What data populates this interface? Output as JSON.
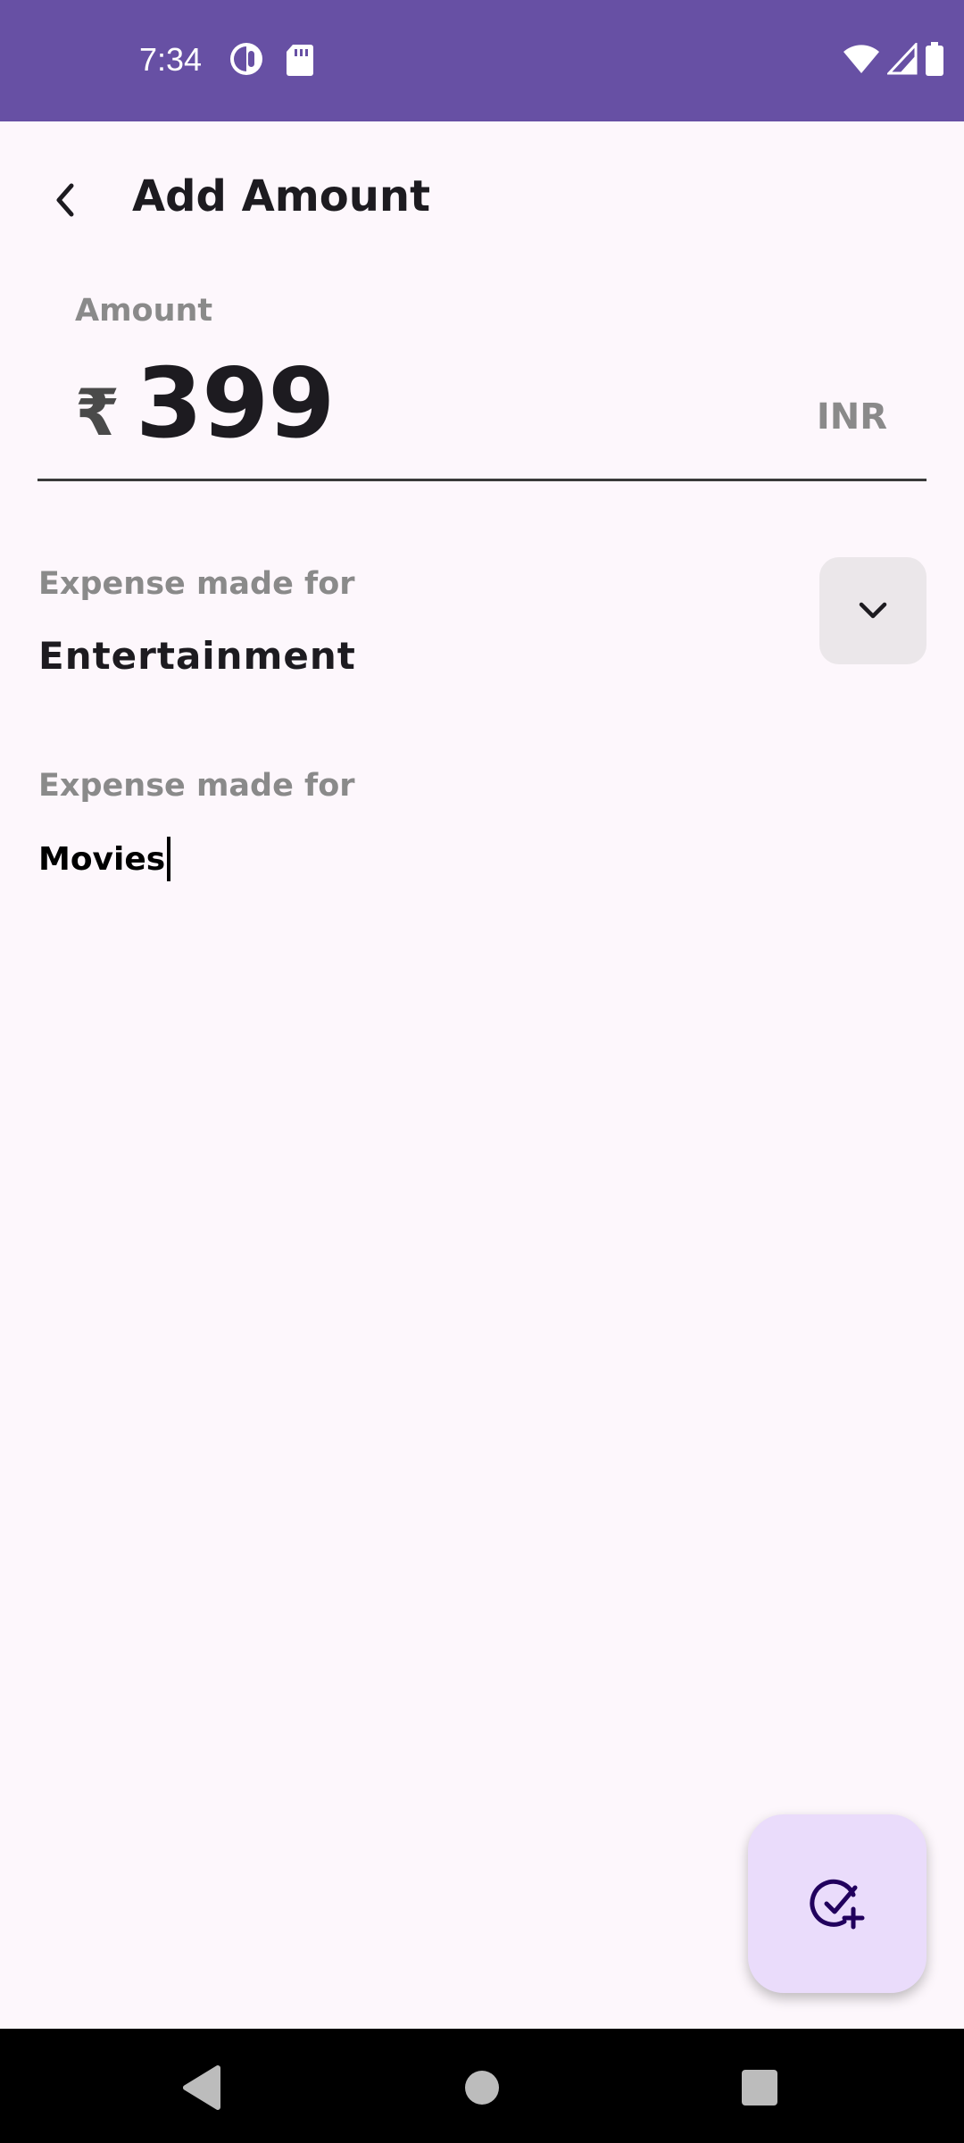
{
  "status_bar": {
    "time": "7:34",
    "icons_left": [
      "data-saver-icon",
      "sd-card-icon"
    ],
    "icons_right": [
      "wifi-icon",
      "signal-icon",
      "battery-icon"
    ]
  },
  "app_bar": {
    "title": "Add Amount",
    "back_icon": "back-arrow-icon"
  },
  "amount": {
    "label": "Amount",
    "currency_symbol": "₹",
    "value": "399",
    "currency_code": "INR"
  },
  "category": {
    "label": "Expense made for",
    "value": "Entertainment",
    "dropdown_icon": "chevron-down-icon"
  },
  "description": {
    "label": "Expense made for",
    "value": "Movies"
  },
  "fab": {
    "icon": "check-circle-add-icon"
  },
  "nav_bar": {
    "buttons": [
      "back-triangle-icon",
      "home-circle-icon",
      "recents-square-icon"
    ]
  },
  "colors": {
    "status_bar": "#6750a4",
    "background": "#fdf7fc",
    "fab": "#eadcfb",
    "dropdown": "#ebe7ea"
  }
}
